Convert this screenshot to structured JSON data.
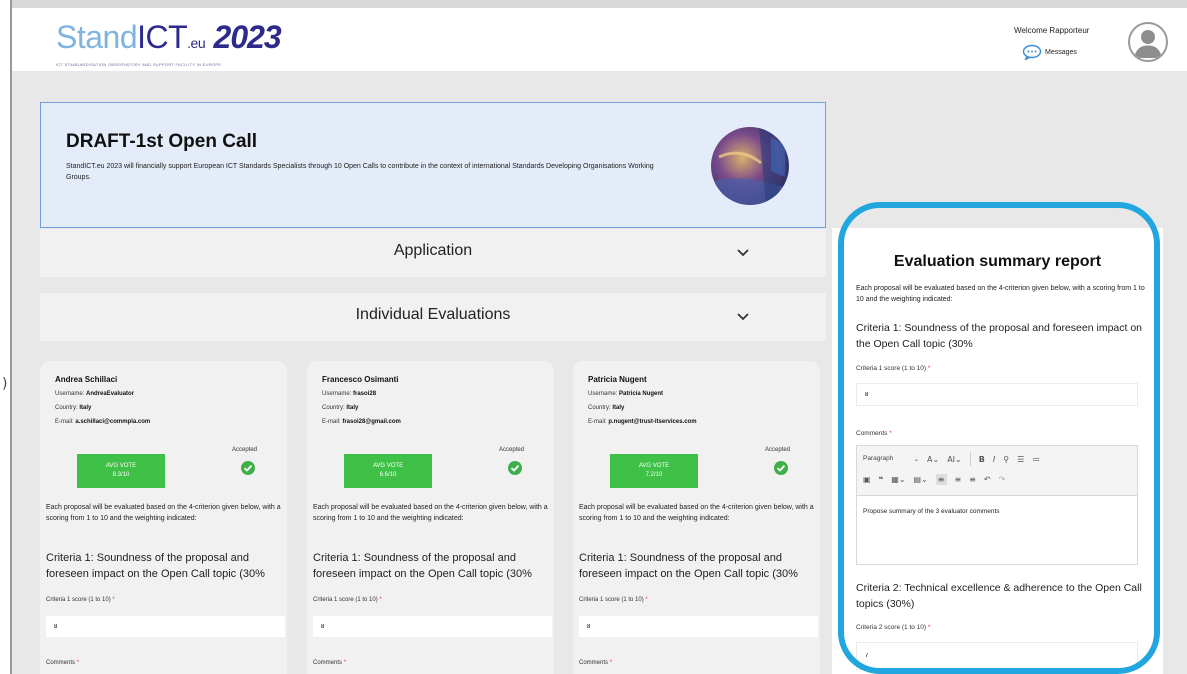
{
  "header": {
    "logo_part1": "Stand",
    "logo_part2": "ICT",
    "logo_part3": ".eu",
    "logo_part4": "2023",
    "logo_tagline": "ICT STANDARDISATION OBSERVATORY AND SUPPORT FACILITY IN EUROPE",
    "welcome": "Welcome Rapporteur",
    "messages_label": "Messages",
    "avatar_icon": "user-avatar-icon",
    "messages_icon": "chat-bubble-icon"
  },
  "banner": {
    "title": "DRAFT-1st Open Call",
    "description": "StandICT.eu 2023 will financially support European ICT Standards Specialists through 10 Open Calls to contribute in the context of international Standards Developing Organisations Working Groups."
  },
  "sections": {
    "application": "Application",
    "individual_evaluations": "Individual Evaluations"
  },
  "evaluators": [
    {
      "name": "Andrea Schillaci",
      "username_label": "Username:",
      "username": "AndreaEvaluator",
      "country_label": "Country:",
      "country": "Italy",
      "email_label": "E-mail:",
      "email": "a.schillaci@commpla.com",
      "status": "Accepted",
      "vote_label": "AVG VOTE",
      "vote_value": "8.3/10",
      "description": "Each proposal will be evaluated based on the 4-criterion given below, with a scoring from 1 to 10 and the weighting indicated:",
      "criteria_title": "Criteria 1: Soundness of the proposal and foreseen impact on the Open Call topic (30%",
      "score_label": "Criteria 1 score (1 to 10)",
      "score_value": "8",
      "comments_label": "Comments"
    },
    {
      "name": "Francesco Osimanti",
      "username_label": "Username:",
      "username": "frasoi28",
      "country_label": "Country:",
      "country": "Italy",
      "email_label": "E-mail:",
      "email": "frasoi28@gmail.com",
      "status": "Accepted",
      "vote_label": "AVG VOTE",
      "vote_value": "6.6/10",
      "description": "Each proposal will be evaluated based on the 4-criterion given below, with a scoring from 1 to 10 and the weighting indicated:",
      "criteria_title": "Criteria 1: Soundness of the proposal and foreseen impact on the Open Call topic (30%",
      "score_label": "Criteria 1 score (1 to 10)",
      "score_value": "8",
      "comments_label": "Comments"
    },
    {
      "name": "Patricia Nugent",
      "username_label": "Username:",
      "username": "Patricia Nugent",
      "country_label": "Country:",
      "country": "Italy",
      "email_label": "E-mail:",
      "email": "p.nugent@trust-itservices.com",
      "status": "Accepted",
      "vote_label": "AVG VOTE",
      "vote_value": "7.2/10",
      "description": "Each proposal will be evaluated based on the 4-criterion given below, with a scoring from 1 to 10 and the weighting indicated:",
      "criteria_title": "Criteria 1: Soundness of the proposal and foreseen impact on the Open Call topic (30%",
      "score_label": "Criteria 1 score (1 to 10)",
      "score_value": "8",
      "comments_label": "Comments"
    }
  ],
  "summary": {
    "title": "Evaluation summary report",
    "intro": "Each proposal will be evaluated based on the 4-criterion given below, with a scoring from 1 to 10 and the weighting indicated:",
    "criteria1_title": "Criteria 1: Soundness of the proposal and foreseen impact on the Open Call topic (30%",
    "criteria1_score_label": "Criteria 1 score (1 to 10)",
    "criteria1_score_value": "8",
    "comments_label": "Comments",
    "editor": {
      "paragraph_select": "Paragraph",
      "body_text": "Propose summary of the 3 evaluator comments"
    },
    "criteria2_title": "Criteria 2: Technical excellence & adherence to the Open Call topics (30%)",
    "criteria2_score_label": "Criteria 2 score (1 to 10)",
    "criteria2_score_value": "7"
  },
  "required_marker": "*",
  "colors": {
    "accent_ring": "#22a6df",
    "vote_green": "#3fc046",
    "check_green": "#3fae49",
    "banner_bg": "#e3ecf8",
    "banner_border": "#6f9fd6",
    "logo_dark": "#2d2a8c",
    "logo_light": "#7fb3e0"
  }
}
